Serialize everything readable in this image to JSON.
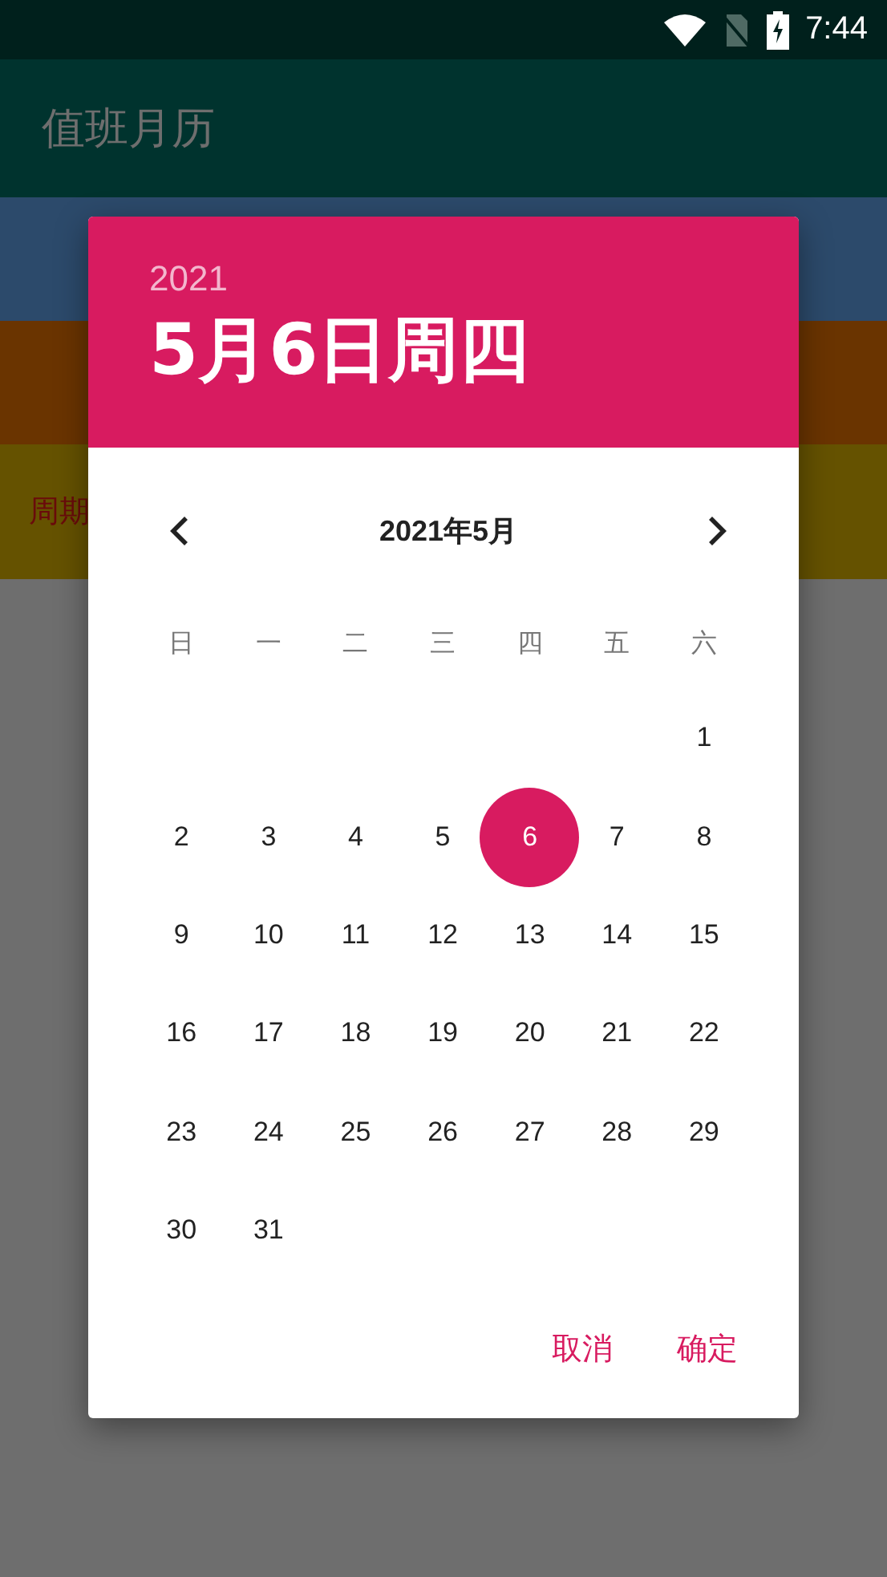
{
  "status_bar": {
    "time": "7:44"
  },
  "app_bar": {
    "title": "值班月历"
  },
  "bands": [
    {
      "color": "#2c4a6b"
    },
    {
      "color": "#6a3400"
    },
    {
      "color": "#655200",
      "label": "周期"
    }
  ],
  "dialog": {
    "year": "2021",
    "date": "5月6日周四",
    "month": "2021年5月",
    "weekdays": [
      "日",
      "一",
      "二",
      "三",
      "四",
      "五",
      "六"
    ],
    "weeks": [
      {
        "kind": "leading",
        "days": [
          {
            "label": "1",
            "selected": false
          }
        ]
      },
      {
        "kind": "full",
        "days": [
          {
            "label": "2",
            "selected": false
          },
          {
            "label": "3",
            "selected": false
          },
          {
            "label": "4",
            "selected": false
          },
          {
            "label": "5",
            "selected": false
          },
          {
            "label": "6",
            "selected": true
          },
          {
            "label": "7",
            "selected": false
          },
          {
            "label": "8",
            "selected": false
          }
        ]
      },
      {
        "kind": "full",
        "days": [
          {
            "label": "9",
            "selected": false
          },
          {
            "label": "10",
            "selected": false
          },
          {
            "label": "11",
            "selected": false
          },
          {
            "label": "12",
            "selected": false
          },
          {
            "label": "13",
            "selected": false
          },
          {
            "label": "14",
            "selected": false
          },
          {
            "label": "15",
            "selected": false
          }
        ]
      },
      {
        "kind": "full",
        "days": [
          {
            "label": "16",
            "selected": false
          },
          {
            "label": "17",
            "selected": false
          },
          {
            "label": "18",
            "selected": false
          },
          {
            "label": "19",
            "selected": false
          },
          {
            "label": "20",
            "selected": false
          },
          {
            "label": "21",
            "selected": false
          },
          {
            "label": "22",
            "selected": false
          }
        ]
      },
      {
        "kind": "full",
        "days": [
          {
            "label": "23",
            "selected": false
          },
          {
            "label": "24",
            "selected": false
          },
          {
            "label": "25",
            "selected": false
          },
          {
            "label": "26",
            "selected": false
          },
          {
            "label": "27",
            "selected": false
          },
          {
            "label": "28",
            "selected": false
          },
          {
            "label": "29",
            "selected": false
          }
        ]
      },
      {
        "kind": "trailing",
        "days": [
          {
            "label": "30",
            "selected": false
          },
          {
            "label": "31",
            "selected": false
          }
        ]
      }
    ],
    "buttons": [
      "取消",
      "确定"
    ]
  }
}
